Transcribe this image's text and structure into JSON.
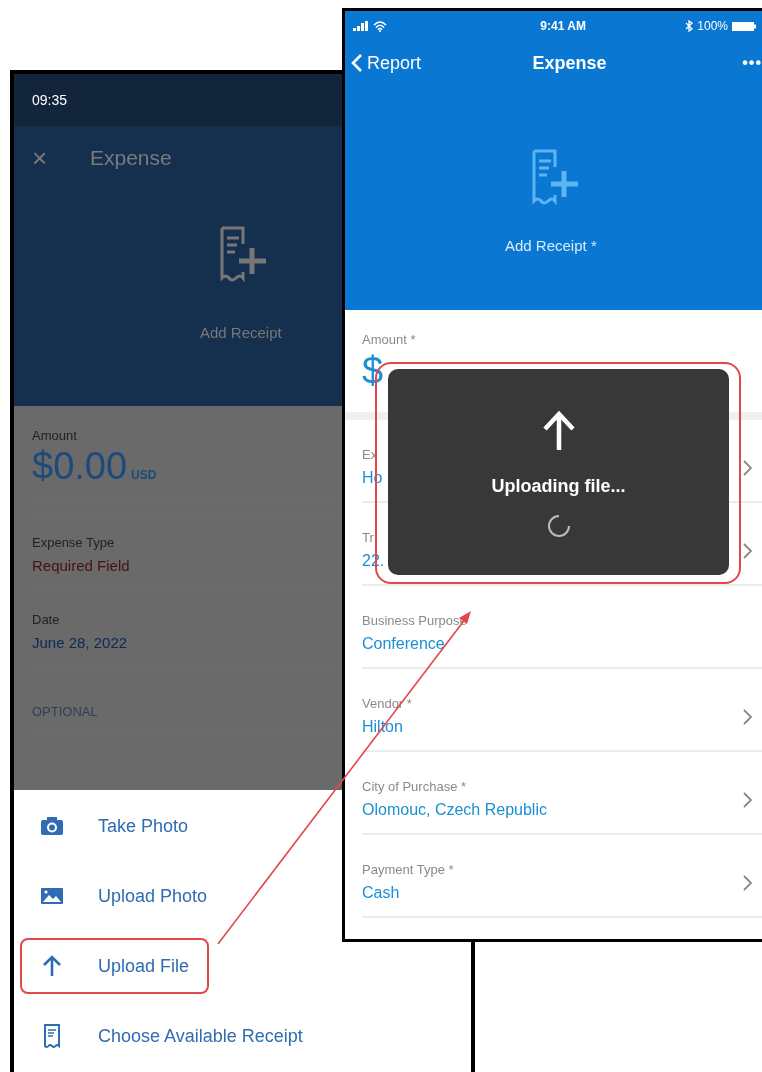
{
  "left_screen": {
    "status_time": "09:35",
    "close": "×",
    "title": "Expense",
    "add_receipt": "Add Receipt",
    "amount": {
      "label": "Amount",
      "value": "$0.00",
      "currency": "USD"
    },
    "fields": [
      {
        "label": "Expense Type",
        "value": "Required Field",
        "invalid": true
      },
      {
        "label": "Date",
        "value": "June 28, 2022",
        "invalid": false
      }
    ],
    "section_label": "OPTIONAL",
    "action_sheet": [
      {
        "kind": "camera",
        "label": "Take Photo",
        "highlighted": false
      },
      {
        "kind": "image",
        "label": "Upload Photo",
        "highlighted": false
      },
      {
        "kind": "upload",
        "label": "Upload File",
        "highlighted": true
      },
      {
        "kind": "receipt",
        "label": "Choose Available Receipt",
        "highlighted": false
      }
    ]
  },
  "right_screen": {
    "status": {
      "time": "9:41 AM",
      "battery": "100%"
    },
    "back": "Report",
    "title": "Expense",
    "more": "•••",
    "add_receipt": "Add Receipt *",
    "amount": {
      "label": "Amount *",
      "value": "$"
    },
    "fields": [
      {
        "label": "Ex",
        "value": "Ho",
        "chevron": true
      },
      {
        "label": "Tr",
        "value": "22.",
        "chevron": true
      },
      {
        "label": "Business Purpose",
        "value": "Conference",
        "chevron": false
      },
      {
        "label": "Vendor *",
        "value": "Hilton",
        "chevron": true
      },
      {
        "label": "City of Purchase *",
        "value": "Olomouc, Czech Republic",
        "chevron": true
      },
      {
        "label": "Payment Type *",
        "value": "Cash",
        "chevron": true
      }
    ],
    "upload_toast": {
      "text": "Uploading file...",
      "highlighted": true
    }
  }
}
